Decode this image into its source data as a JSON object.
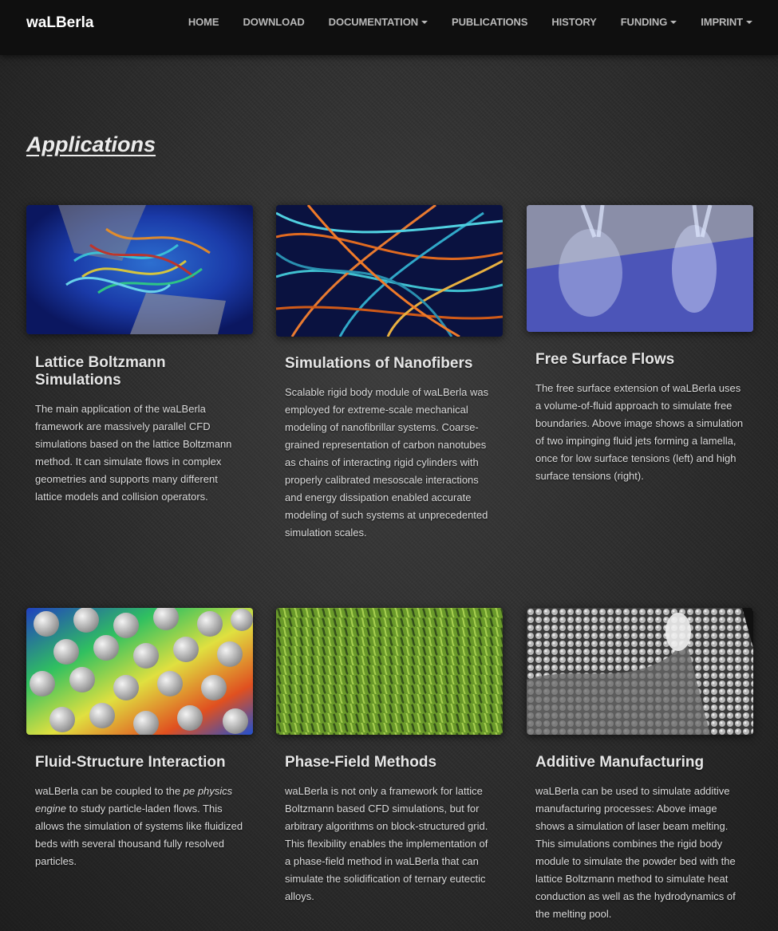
{
  "brand": "waLBerla",
  "nav": {
    "home": "HOME",
    "download": "DOWNLOAD",
    "documentation": "DOCUMENTATION",
    "publications": "PUBLICATIONS",
    "history": "HISTORY",
    "funding": "FUNDING",
    "imprint": "IMPRINT"
  },
  "page_title": "Applications",
  "cards": [
    {
      "title": "Lattice Boltzmann Simulations",
      "text": "The main application of the waLBerla framework are massively parallel CFD simulations based on the lattice Boltzmann method. It can simulate flows in complex geometries and supports many different lattice models and collision operators."
    },
    {
      "title": "Simulations of Nanofibers",
      "text": "Scalable rigid body module of waLBerla was employed for extreme-scale mechanical modeling of nanofibrillar systems. Coarse-grained representation of carbon nanotubes as chains of interacting rigid cylinders with properly calibrated mesoscale interactions and energy dissipation enabled accurate modeling of such systems at unprecedented simulation scales."
    },
    {
      "title": "Free Surface Flows",
      "text": "The free surface extension of waLBerla uses a volume-of-fluid approach to simulate free boundaries. Above image shows a simulation of two impinging fluid jets forming a lamella, once for low surface tensions (left) and high surface tensions (right)."
    },
    {
      "title": "Fluid-Structure Interaction",
      "text_pre": "waLBerla can be coupled to the ",
      "text_em": "pe physics engine",
      "text_post": " to study particle-laden flows. This allows the simulation of systems like fluidized beds with several thousand fully resolved particles."
    },
    {
      "title": "Phase-Field Methods",
      "text": "waLBerla is not only a framework for lattice Boltzmann based CFD simulations, but for arbitrary algorithms on block-structured grid. This flexibility enables the implementation of a phase-field method in waLBerla that can simulate the solidification of ternary eutectic alloys."
    },
    {
      "title": "Additive Manufacturing",
      "text": "waLBerla can be used to simulate additive manufacturing processes: Above image shows a simulation of laser beam melting. This simulations combines the rigid body module to simulate the powder bed with the lattice Boltzmann method to simulate heat conduction as well as the hydrodynamics of the melting pool."
    }
  ]
}
